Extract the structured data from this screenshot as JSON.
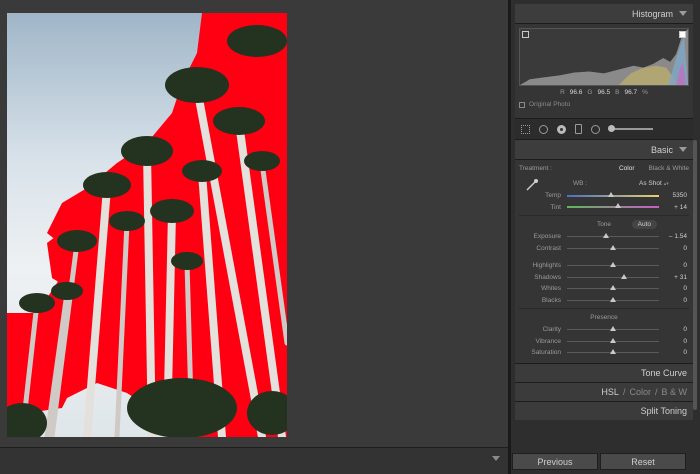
{
  "histogram": {
    "title": "Histogram",
    "r_label": "R",
    "r_value": "96.6",
    "g_label": "G",
    "g_value": "96.5",
    "b_label": "B",
    "b_value": "96.7",
    "unit": "%",
    "original_photo": "Original Photo"
  },
  "basic": {
    "title": "Basic",
    "treatment_label": "Treatment :",
    "treatment_color": "Color",
    "treatment_bw": "Black & White",
    "wb_label": "WB :",
    "wb_value": "As Shot",
    "temp": {
      "label": "Temp",
      "value": "5350",
      "pos": 0.48
    },
    "tint": {
      "label": "Tint",
      "value": "+ 14",
      "pos": 0.55
    },
    "tone_title": "Tone",
    "auto_label": "Auto",
    "exposure": {
      "label": "Exposure",
      "value": "– 1.54",
      "pos": 0.42
    },
    "contrast": {
      "label": "Contrast",
      "value": "0",
      "pos": 0.5
    },
    "highlights": {
      "label": "Highlights",
      "value": "0",
      "pos": 0.5
    },
    "shadows": {
      "label": "Shadows",
      "value": "+ 31",
      "pos": 0.62
    },
    "whites": {
      "label": "Whites",
      "value": "0",
      "pos": 0.5
    },
    "blacks": {
      "label": "Blacks",
      "value": "0",
      "pos": 0.5
    },
    "presence_title": "Presence",
    "clarity": {
      "label": "Clarity",
      "value": "0",
      "pos": 0.5
    },
    "vibrance": {
      "label": "Vibrance",
      "value": "0",
      "pos": 0.5
    },
    "saturation": {
      "label": "Saturation",
      "value": "0",
      "pos": 0.5
    }
  },
  "panels": {
    "tone_curve": "Tone Curve",
    "hsl": "HSL",
    "color": "Color",
    "bw": "B & W",
    "split_toning": "Split Toning",
    "sep": "/"
  },
  "buttons": {
    "previous": "Previous",
    "reset": "Reset"
  },
  "colors": {
    "mask_red": "#ff0012"
  }
}
